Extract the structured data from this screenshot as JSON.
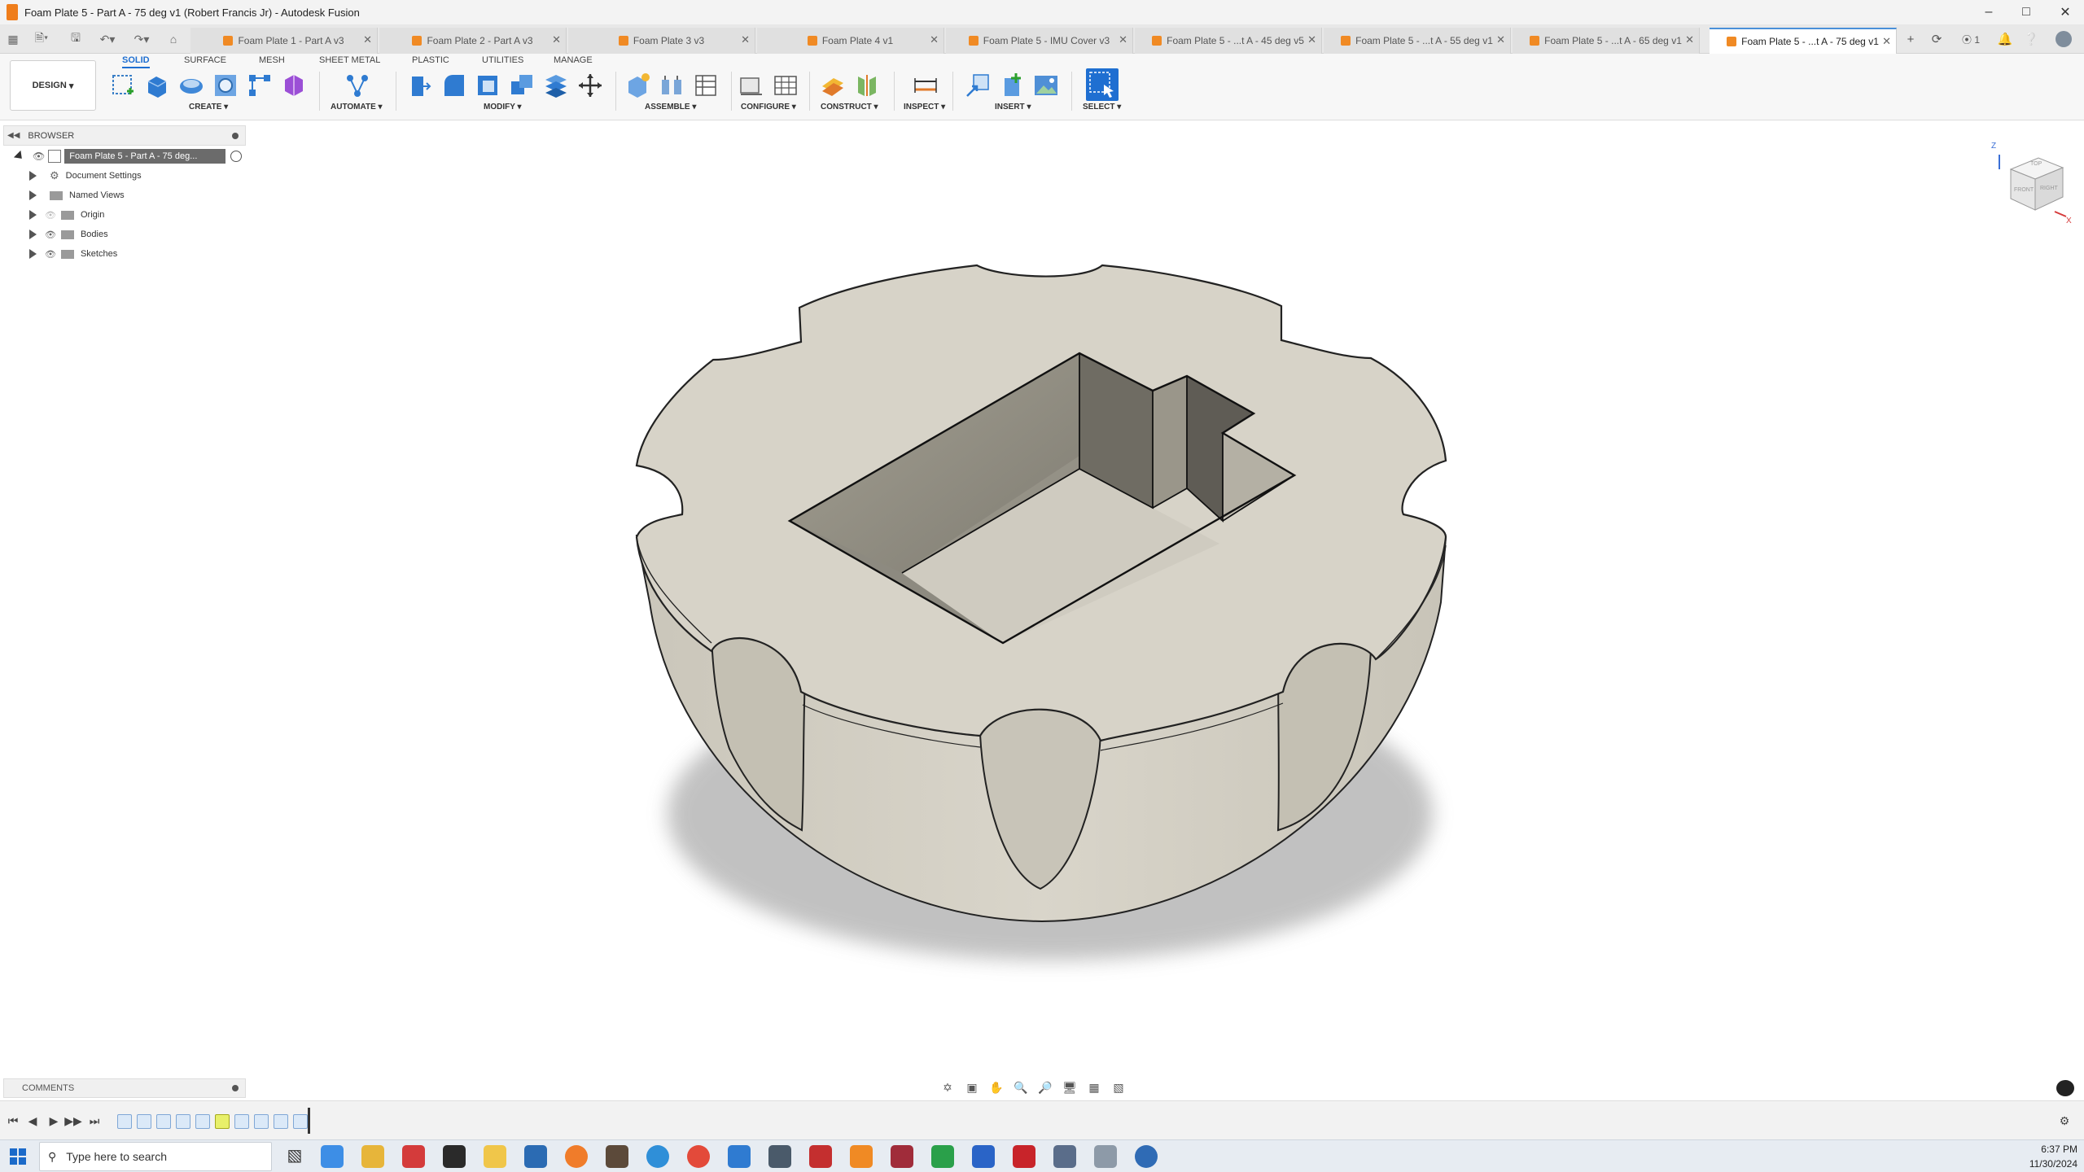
{
  "window": {
    "title": "Foam Plate 5 - Part A - 75 deg v1 (Robert Francis Jr) - Autodesk Fusion"
  },
  "tabs": [
    {
      "label": "Foam Plate 1 - Part A v3"
    },
    {
      "label": "Foam Plate 2 - Part A v3"
    },
    {
      "label": "Foam Plate 3 v3"
    },
    {
      "label": "Foam Plate 4 v1"
    },
    {
      "label": "Foam Plate 5 - IMU Cover v3"
    },
    {
      "label": "Foam Plate 5 - ...t A - 45 deg v5"
    },
    {
      "label": "Foam Plate 5 - ...t A - 55 deg v1"
    },
    {
      "label": "Foam Plate 5 - ...t A - 65 deg v1"
    },
    {
      "label": "Foam Plate 5 - ...t A - 75 deg v1"
    }
  ],
  "toolbar": {
    "design_label": "DESIGN",
    "workspace_tabs": [
      "SOLID",
      "SURFACE",
      "MESH",
      "SHEET METAL",
      "PLASTIC",
      "UTILITIES",
      "MANAGE"
    ],
    "groups": [
      "CREATE",
      "AUTOMATE",
      "MODIFY",
      "ASSEMBLE",
      "CONFIGURE",
      "CONSTRUCT",
      "INSPECT",
      "INSERT",
      "SELECT"
    ]
  },
  "browser": {
    "title": "BROWSER",
    "root": "Foam Plate 5 - Part A - 75 deg...",
    "items": [
      "Document Settings",
      "Named Views",
      "Origin",
      "Bodies",
      "Sketches"
    ]
  },
  "viewcube": {
    "z": "Z",
    "x": "X",
    "top": "TOP",
    "front": "FRONT",
    "right": "RIGHT"
  },
  "comments": {
    "title": "COMMENTS"
  },
  "taskbar": {
    "search_placeholder": "Type here to search",
    "time": "6:37 PM",
    "date": "11/30/2024"
  },
  "colors": {
    "accent": "#1f6fd1",
    "model": "#d8d5cb",
    "orange": "#f08a24"
  }
}
